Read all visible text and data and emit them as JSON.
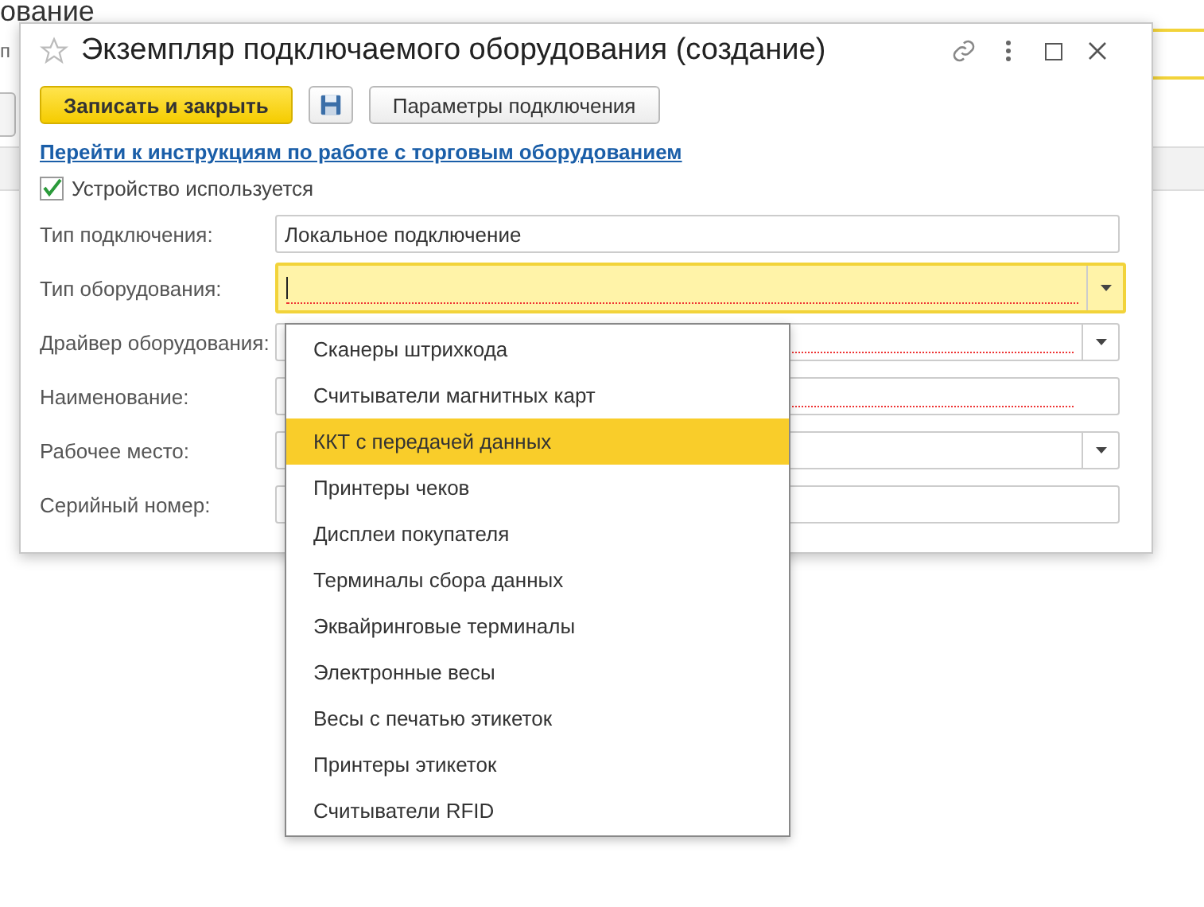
{
  "background": {
    "heading": "ование",
    "field_label": "п"
  },
  "dialog": {
    "title": "Экземпляр подключаемого оборудования (создание)"
  },
  "buttons": [
    {
      "kind": "primary",
      "label": "Записать и закрыть"
    },
    {
      "kind": "save"
    },
    {
      "kind": "default",
      "label": "Параметры подключения"
    }
  ],
  "link": "Перейти к инструкциям по работе с торговым оборудованием",
  "checkbox": {
    "label": "Устройство используется",
    "checked": true
  },
  "fields": [
    {
      "label": "Тип подключения:",
      "kind": "text",
      "value": "Локальное подключение",
      "focused": false,
      "required": false
    },
    {
      "label": "Тип оборудования:",
      "kind": "dropdown",
      "focused": true,
      "required": true
    },
    {
      "label": "Драйвер оборудования:",
      "kind": "dropdown",
      "focused": false,
      "required": true
    },
    {
      "label": "Наименование:",
      "kind": "text",
      "focused": false,
      "required": true
    },
    {
      "label": "Рабочее место:",
      "kind": "dropdown",
      "focused": false,
      "required": false
    },
    {
      "label": "Серийный номер:",
      "kind": "text",
      "focused": false,
      "required": false
    }
  ],
  "dropdown_list": [
    {
      "label": "Сканеры штрихкода",
      "selected": false
    },
    {
      "label": "Считыватели магнитных карт",
      "selected": false
    },
    {
      "label": "ККТ с передачей данных",
      "selected": true
    },
    {
      "label": "Принтеры чеков",
      "selected": false
    },
    {
      "label": "Дисплеи покупателя",
      "selected": false
    },
    {
      "label": "Терминалы сбора данных",
      "selected": false
    },
    {
      "label": "Эквайринговые терминалы",
      "selected": false
    },
    {
      "label": "Электронные весы",
      "selected": false
    },
    {
      "label": "Весы с печатью этикеток",
      "selected": false
    },
    {
      "label": "Принтеры этикеток",
      "selected": false
    },
    {
      "label": "Считыватели RFID",
      "selected": false
    }
  ]
}
